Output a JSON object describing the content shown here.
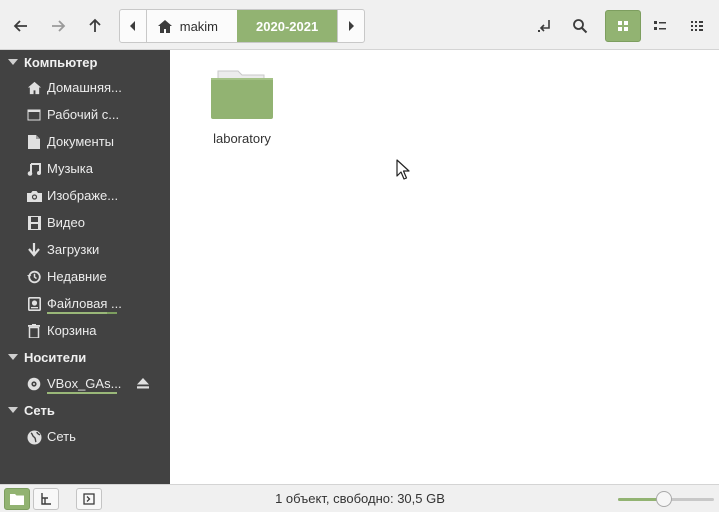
{
  "toolbar": {
    "buttons": [
      {
        "name": "back",
        "icon": "arrow-left-icon"
      },
      {
        "name": "forward",
        "icon": "arrow-right-icon"
      },
      {
        "name": "up",
        "icon": "arrow-up-icon"
      }
    ],
    "pathbar": {
      "crumbs": [
        {
          "label": "makim",
          "icon": "home-icon"
        },
        {
          "label": "2020-2021",
          "selected": true
        }
      ]
    },
    "view_mode": "icons"
  },
  "sidebar": {
    "sections": [
      {
        "title": "Компьютер",
        "items": [
          {
            "label": "Домашняя...",
            "icon": "home-icon"
          },
          {
            "label": "Рабочий с...",
            "icon": "desktop-icon"
          },
          {
            "label": "Документы",
            "icon": "document-icon"
          },
          {
            "label": "Музыка",
            "icon": "music-icon"
          },
          {
            "label": "Изображе...",
            "icon": "camera-icon"
          },
          {
            "label": "Видео",
            "icon": "film-icon"
          },
          {
            "label": "Загрузки",
            "icon": "download-icon"
          },
          {
            "label": "Недавние",
            "icon": "history-icon"
          },
          {
            "label": "Файловая ...",
            "icon": "drive-icon",
            "usage": 0.85
          },
          {
            "label": "Корзина",
            "icon": "trash-icon"
          }
        ]
      },
      {
        "title": "Носители",
        "items": [
          {
            "label": "VBox_GAs...",
            "icon": "disc-icon",
            "usage": 1.0,
            "eject": true
          }
        ]
      },
      {
        "title": "Сеть",
        "items": [
          {
            "label": "Сеть",
            "icon": "network-icon"
          }
        ]
      }
    ]
  },
  "main": {
    "items": [
      {
        "label": "laboratory",
        "type": "folder",
        "color": "#92b372"
      }
    ]
  },
  "statusbar": {
    "text": "1 объект, свободно: 30,5 GB",
    "zoom_level": 0.48
  },
  "colors": {
    "accent": "#92b372",
    "sidebar_bg": "#424242"
  }
}
